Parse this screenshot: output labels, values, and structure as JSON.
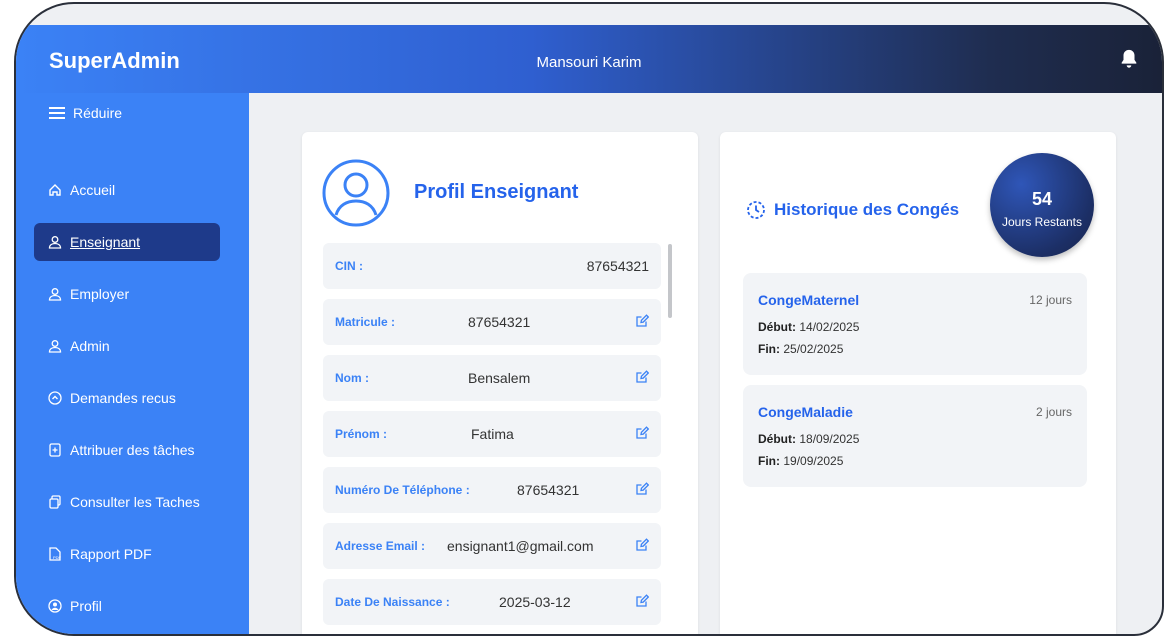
{
  "header": {
    "brand": "SuperAdmin",
    "user_name": "Mansouri Karim",
    "bell_icon": "bell-icon"
  },
  "sidebar": {
    "collapse_label": "Réduire",
    "items": [
      {
        "label": "Accueil",
        "icon": "home-icon"
      },
      {
        "label": "Enseignant",
        "icon": "user-icon",
        "active": true
      },
      {
        "label": "Employer",
        "icon": "user-icon"
      },
      {
        "label": "Admin",
        "icon": "user-icon"
      },
      {
        "label": "Demandes recus",
        "icon": "circle-arrow-icon"
      },
      {
        "label": "Attribuer des tâches",
        "icon": "file-plus-icon"
      },
      {
        "label": "Consulter les Taches",
        "icon": "copy-icon"
      },
      {
        "label": "Rapport PDF",
        "icon": "pdf-icon"
      },
      {
        "label": "Profil",
        "icon": "user-circle-icon"
      }
    ]
  },
  "profile": {
    "title": "Profil Enseignant",
    "fields": [
      {
        "label": "CIN :",
        "value": "87654321",
        "editable": false
      },
      {
        "label": "Matricule :",
        "value": "87654321",
        "editable": true
      },
      {
        "label": "Nom :",
        "value": "Bensalem",
        "editable": true
      },
      {
        "label": "Prénom :",
        "value": "Fatima",
        "editable": true
      },
      {
        "label": "Numéro De Téléphone :",
        "value": "87654321",
        "editable": true
      },
      {
        "label": "Adresse Email :",
        "value": "ensignant1@gmail.com",
        "editable": true
      },
      {
        "label": "Date De Naissance :",
        "value": "2025-03-12",
        "editable": true
      }
    ]
  },
  "history": {
    "title": "Historique des Congés",
    "remaining_days": "54",
    "remaining_label": "Jours Restants",
    "leaves": [
      {
        "type": "CongeMaternel",
        "days": "12 jours",
        "start_label": "Début:",
        "start": "14/02/2025",
        "end_label": "Fin:",
        "end": "25/02/2025"
      },
      {
        "type": "CongeMaladie",
        "days": "2 jours",
        "start_label": "Début:",
        "start": "18/09/2025",
        "end_label": "Fin:",
        "end": "19/09/2025"
      }
    ]
  },
  "colors": {
    "accent": "#3b82f6",
    "title_blue": "#2563eb",
    "active_nav": "#1e3a8a",
    "dark_navy": "#1a2238"
  }
}
